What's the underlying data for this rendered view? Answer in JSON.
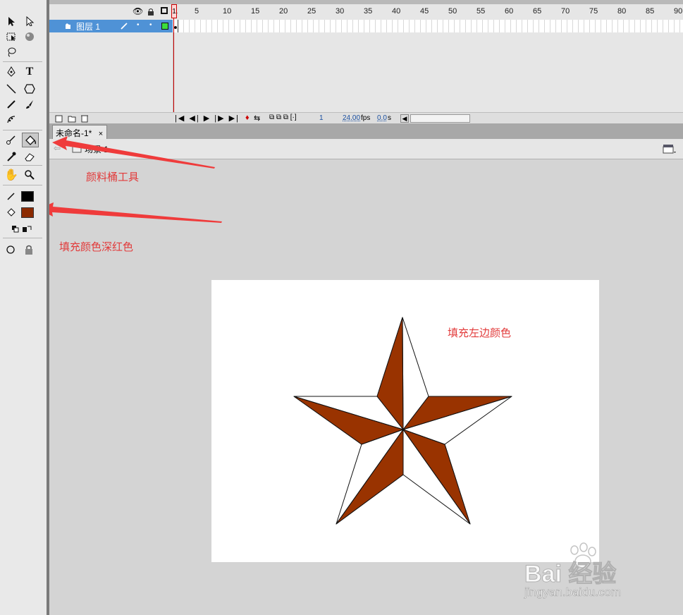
{
  "timeline": {
    "frame_numbers": [
      "1",
      "5",
      "10",
      "15",
      "20",
      "25",
      "30",
      "35",
      "40",
      "45",
      "50",
      "55",
      "60",
      "65",
      "70",
      "75",
      "80",
      "85",
      "90"
    ],
    "layer_name": "图层 1",
    "current_frame": "1",
    "fps": "24.00",
    "fps_unit": "fps",
    "time": "0.0",
    "time_unit": "s"
  },
  "document": {
    "tab_title": "未命名-1*",
    "tab_close": "×",
    "scene_label": "场景 1"
  },
  "colors": {
    "stroke_color": "#000000",
    "fill_color": "#8b2a00",
    "star_fill": "#993300",
    "annotation": "#e23b3b",
    "layer_highlight": "#4f92d6"
  },
  "annotations": {
    "paint_bucket": "颜料桶工具",
    "fill_color": "填充颜色深红色",
    "fill_left": "填充左边颜色"
  },
  "watermark": {
    "brand": "Bai 经验",
    "url": "jingyan.baidu.com"
  }
}
